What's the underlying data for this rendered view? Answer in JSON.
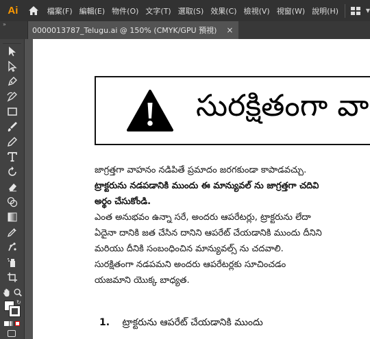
{
  "app": {
    "logo": "Ai"
  },
  "menu": {
    "items": [
      "檔案(F)",
      "編輯(E)",
      "物件(O)",
      "文字(T)",
      "選取(S)",
      "效果(C)",
      "檢視(V)",
      "視窗(W)",
      "說明(H)"
    ]
  },
  "tab": {
    "title": "0000013787_Telugu.ai @ 150% (CMYK/GPU 預視)",
    "close": "×"
  },
  "toolbar": {
    "collapse": "»",
    "tools": [
      "selection-tool",
      "direct-selection-tool",
      "pen-tool",
      "curvature-tool",
      "rectangle-tool",
      "paintbrush-tool",
      "pencil-tool",
      "type-tool",
      "rotate-tool",
      "eraser-tool",
      "shape-builder-tool",
      "gradient-tool",
      "eyedropper-tool",
      "puppet-warp-tool",
      "symbol-sprayer-tool",
      "artboard-tool",
      "hand-tool",
      "zoom-tool"
    ]
  },
  "document": {
    "warning_title": "సురక్షితంగా వా",
    "body_lines": [
      {
        "text": "జాగ్రత్తగా వాహనం నడిపితే ప్రమాదం జరగకుండా కాపాడవచ్చు.",
        "bold": false
      },
      {
        "text": "ట్రాక్టరును నడపడానికి ముందు ఈ మాన్యువల్ ను జాగ్రత్తగా చదివి",
        "bold": true
      },
      {
        "text": "అర్థం చేసుకోండి.",
        "bold": true
      },
      {
        "text": "ఎంత అనుభవం ఉన్నా సరే, అందరు ఆపరేటర్లు, ట్రాక్టరును లేదా",
        "bold": false
      },
      {
        "text": "ఏదైనా దానికి జత చేసిన దానిని ఆపరేట్ చేయడానికి ముందు దీనిని",
        "bold": false
      },
      {
        "text": "మరియు దీనికి సంబంధించిన మాన్యువల్స్ ను చదవాలి.",
        "bold": false
      },
      {
        "text": "సురక్షితంగా నడపమని అందరు ఆపరేటర్లకు సూచించడం",
        "bold": false
      },
      {
        "text": "యజమాని యొక్క బాధ్యత.",
        "bold": false
      }
    ],
    "heading_number": "1.",
    "heading_text": "ట్రాక్టరును ఆపరేట్ చేయడానికి ముందు"
  }
}
